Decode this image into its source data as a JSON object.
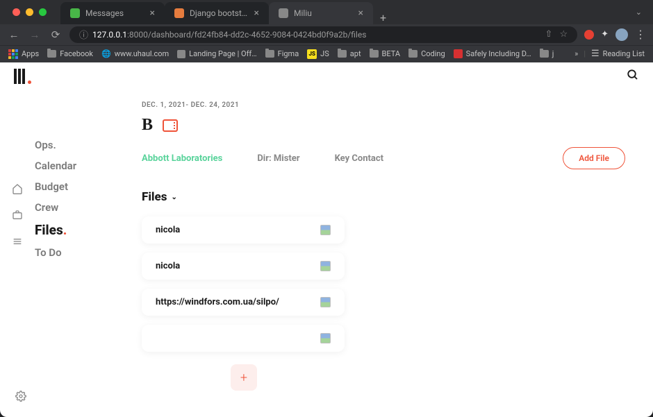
{
  "browser": {
    "tabs": [
      {
        "title": "Messages",
        "favicon": "fav-green"
      },
      {
        "title": "Django bootstrap: File is not b",
        "favicon": "fav-orange"
      },
      {
        "title": "Miliu",
        "favicon": "fav-grey",
        "active": true
      }
    ],
    "address": {
      "host": "127.0.0.1",
      "port": ":8000",
      "path": "/dashboard/fd24fb84-dd2c-4652-9084-0424bd0f9a2b/files"
    },
    "bookmarks": {
      "apps": "Apps",
      "items": [
        "Facebook",
        "www.uhaul.com",
        "Landing Page | Off…",
        "Figma",
        "JS",
        "apt",
        "BETA",
        "Coding",
        "Safely Including D…",
        "j"
      ],
      "reading_list": "Reading List"
    }
  },
  "app": {
    "date_range": "DEC. 1, 2021- DEC. 24, 2021",
    "nav": {
      "items": [
        "Ops.",
        "Calendar",
        "Budget",
        "Crew",
        "Files",
        "To Do"
      ],
      "active": "Files"
    },
    "sub_tabs": {
      "items": [
        "Abbott Laboratories",
        "Dir: Mister",
        "Key Contact"
      ],
      "active": "Abbott Laboratories"
    },
    "add_file": "Add File",
    "files_label": "Files",
    "files": [
      {
        "name": "nicola"
      },
      {
        "name": "nicola"
      },
      {
        "name": "https://windfors.com.ua/silpo/"
      },
      {
        "name": ""
      }
    ]
  }
}
